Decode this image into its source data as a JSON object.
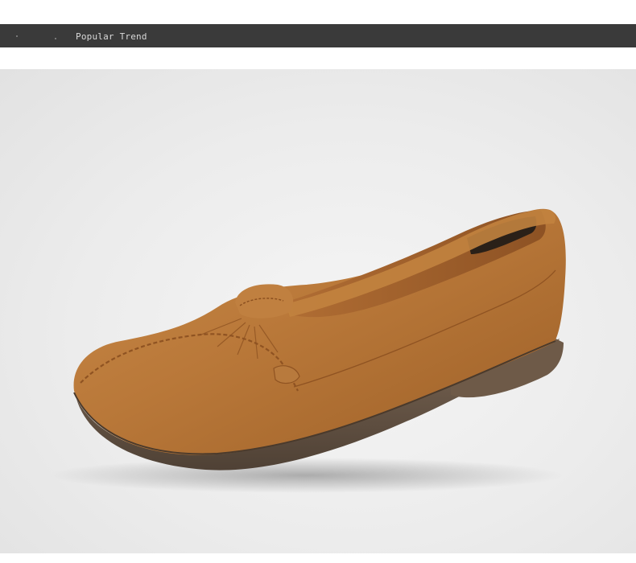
{
  "header": {
    "title": "Popular Trend"
  },
  "photo": {
    "subject": "tan-leather-loafer"
  },
  "colors": {
    "header_bg": "#3a3a3a",
    "header_text": "#d9d9d9",
    "leather": "#b67637",
    "sole": "#6b5a49"
  }
}
